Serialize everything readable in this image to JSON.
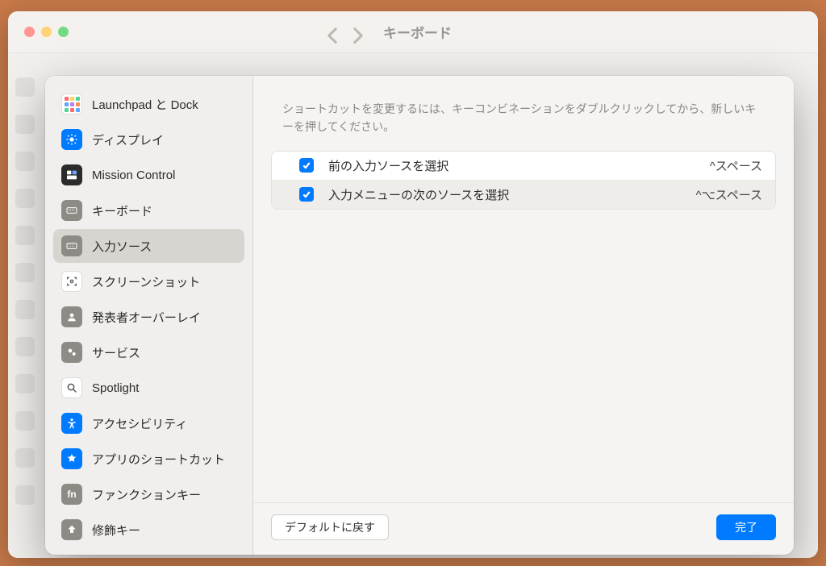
{
  "window": {
    "title": "キーボード"
  },
  "sidebar": {
    "items": [
      {
        "id": "launchpad",
        "label": "Launchpad と Dock"
      },
      {
        "id": "display",
        "label": "ディスプレイ"
      },
      {
        "id": "mission",
        "label": "Mission Control"
      },
      {
        "id": "keyboard",
        "label": "キーボード"
      },
      {
        "id": "input",
        "label": "入力ソース"
      },
      {
        "id": "screenshot",
        "label": "スクリーンショット"
      },
      {
        "id": "presenter",
        "label": "発表者オーバーレイ"
      },
      {
        "id": "services",
        "label": "サービス"
      },
      {
        "id": "spotlight",
        "label": "Spotlight"
      },
      {
        "id": "accessibility",
        "label": "アクセシビリティ"
      },
      {
        "id": "appshortcuts",
        "label": "アプリのショートカット"
      },
      {
        "id": "functionkeys",
        "label": "ファンクションキー"
      },
      {
        "id": "modifierkeys",
        "label": "修飾キー"
      }
    ],
    "selected_index": 4
  },
  "main": {
    "instructions": "ショートカットを変更するには、キーコンビネーションをダブルクリックしてから、新しいキーを押してください。",
    "shortcuts": [
      {
        "enabled": true,
        "label": "前の入力ソースを選択",
        "key": "^スペース"
      },
      {
        "enabled": true,
        "label": "入力メニューの次のソースを選択",
        "key": "^⌥スペース"
      }
    ]
  },
  "footer": {
    "reset_label": "デフォルトに戻す",
    "done_label": "完了"
  },
  "icons": {
    "fn_label": "fn"
  }
}
